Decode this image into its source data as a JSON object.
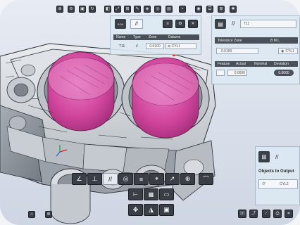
{
  "toolbar": {
    "icons": [
      "zoom-icon",
      "zoom-area-icon",
      "view-icon",
      "refresh-icon",
      "cube-icon",
      "fit-icon",
      "zoom-all-icon",
      "measure-icon",
      "section-icon",
      "target-icon",
      "image-icon",
      "circle-icon",
      "dot-icon",
      "record-icon",
      "list-icon",
      "grid-icon",
      "wrench-icon"
    ]
  },
  "characteristic_panel": {
    "header_icon_label": "0.04",
    "flag_symbol": "//",
    "columns": [
      "Name",
      "Type",
      "Zone",
      "Datums"
    ],
    "row": {
      "name": "T11",
      "type": "//",
      "zone": "0.0100",
      "datums": "⊕ CYL1"
    }
  },
  "tolerance_panel": {
    "symbol": "//",
    "name_value": "T11",
    "zone_label": "Tolerance Zone",
    "zone_unit": "B M L",
    "zone_value": "0.0100",
    "datum_label": "CYL1",
    "result_columns": [
      "Feature",
      "Actual",
      "Nominal",
      "Deviation"
    ],
    "result_values": {
      "actual": "0.0000",
      "nominal": "0.0000"
    }
  },
  "objects_panel": {
    "title": "Objects to Output",
    "symbol": "//",
    "item": "CYL2"
  },
  "bottom_toolbar": {
    "row1": [
      "angle-icon",
      "perpendicular-icon",
      "parallel-icon",
      "concentric-icon",
      "symmetry-icon",
      "position-icon",
      "circular-runout-icon",
      "total-runout-icon",
      "arc-icon"
    ],
    "row2": [
      "axis-icon",
      "datum-icon",
      "frame-icon"
    ],
    "row3": [
      "move-icon",
      "measure-tool-icon",
      "camera-icon"
    ]
  },
  "bottom_right": {
    "mode_label": "2D"
  },
  "colors": {
    "cylinder": "#d0459c",
    "panel_bg": "#dce8f3",
    "dark_btn": "#3a3f47",
    "marker": "#e3261d"
  }
}
